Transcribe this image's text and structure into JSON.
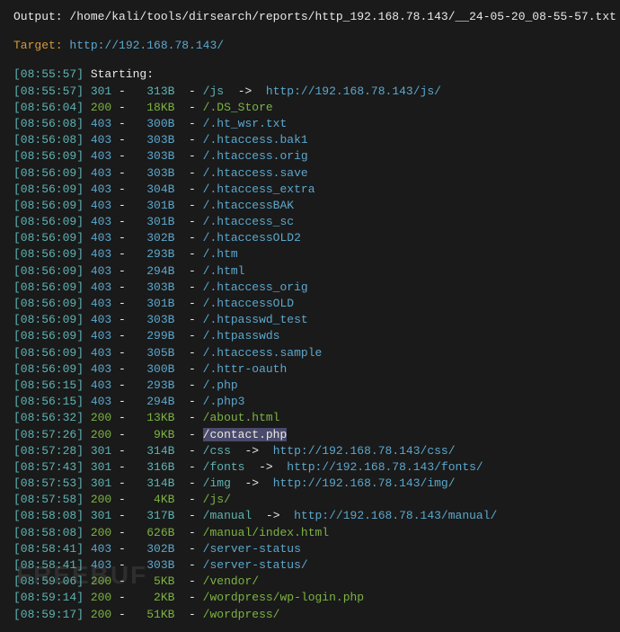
{
  "output_label": "Output: ",
  "output_path": "/home/kali/tools/dirsearch/reports/http_192.168.78.143/__24-05-20_08-55-57.txt",
  "target_label": "Target: ",
  "target_url": "http://192.168.78.143/",
  "starting_ts": "[08:55:57]",
  "starting_label": " Starting: ",
  "rows": [
    {
      "ts": "[08:55:57]",
      "st": "301",
      "sz": "313B",
      "path": "/js ",
      "arrow": " ->",
      "redir": "  http://192.168.78.143/js/",
      "sc": "cyan"
    },
    {
      "ts": "[08:56:04]",
      "st": "200",
      "sz": "18KB",
      "path": "/.DS_Store",
      "sc": "green"
    },
    {
      "ts": "[08:56:08]",
      "st": "403",
      "sz": "300B",
      "path": "/.ht_wsr.txt",
      "sc": "blue"
    },
    {
      "ts": "[08:56:08]",
      "st": "403",
      "sz": "303B",
      "path": "/.htaccess.bak1",
      "sc": "blue"
    },
    {
      "ts": "[08:56:09]",
      "st": "403",
      "sz": "303B",
      "path": "/.htaccess.orig",
      "sc": "blue"
    },
    {
      "ts": "[08:56:09]",
      "st": "403",
      "sz": "303B",
      "path": "/.htaccess.save",
      "sc": "blue"
    },
    {
      "ts": "[08:56:09]",
      "st": "403",
      "sz": "304B",
      "path": "/.htaccess_extra",
      "sc": "blue"
    },
    {
      "ts": "[08:56:09]",
      "st": "403",
      "sz": "301B",
      "path": "/.htaccessBAK",
      "sc": "blue"
    },
    {
      "ts": "[08:56:09]",
      "st": "403",
      "sz": "301B",
      "path": "/.htaccess_sc",
      "sc": "blue"
    },
    {
      "ts": "[08:56:09]",
      "st": "403",
      "sz": "302B",
      "path": "/.htaccessOLD2",
      "sc": "blue"
    },
    {
      "ts": "[08:56:09]",
      "st": "403",
      "sz": "293B",
      "path": "/.htm",
      "sc": "blue"
    },
    {
      "ts": "[08:56:09]",
      "st": "403",
      "sz": "294B",
      "path": "/.html",
      "sc": "blue"
    },
    {
      "ts": "[08:56:09]",
      "st": "403",
      "sz": "303B",
      "path": "/.htaccess_orig",
      "sc": "blue"
    },
    {
      "ts": "[08:56:09]",
      "st": "403",
      "sz": "301B",
      "path": "/.htaccessOLD",
      "sc": "blue"
    },
    {
      "ts": "[08:56:09]",
      "st": "403",
      "sz": "303B",
      "path": "/.htpasswd_test",
      "sc": "blue"
    },
    {
      "ts": "[08:56:09]",
      "st": "403",
      "sz": "299B",
      "path": "/.htpasswds",
      "sc": "blue"
    },
    {
      "ts": "[08:56:09]",
      "st": "403",
      "sz": "305B",
      "path": "/.htaccess.sample",
      "sc": "blue"
    },
    {
      "ts": "[08:56:09]",
      "st": "403",
      "sz": "300B",
      "path": "/.httr-oauth",
      "sc": "blue"
    },
    {
      "ts": "[08:56:15]",
      "st": "403",
      "sz": "293B",
      "path": "/.php",
      "sc": "blue"
    },
    {
      "ts": "[08:56:15]",
      "st": "403",
      "sz": "294B",
      "path": "/.php3",
      "sc": "blue"
    },
    {
      "ts": "[08:56:32]",
      "st": "200",
      "sz": "13KB",
      "path": "/about.html",
      "sc": "green"
    },
    {
      "ts": "[08:57:26]",
      "st": "200",
      "sz": "9KB",
      "path": "/contact.php",
      "sc": "green",
      "hl": true
    },
    {
      "ts": "[08:57:28]",
      "st": "301",
      "sz": "314B",
      "path": "/css ",
      "arrow": " ->",
      "redir": "  http://192.168.78.143/css/",
      "sc": "cyan"
    },
    {
      "ts": "[08:57:43]",
      "st": "301",
      "sz": "316B",
      "path": "/fonts ",
      "arrow": " ->",
      "redir": "  http://192.168.78.143/fonts/",
      "sc": "cyan"
    },
    {
      "ts": "[08:57:53]",
      "st": "301",
      "sz": "314B",
      "path": "/img ",
      "arrow": " ->",
      "redir": "  http://192.168.78.143/img/",
      "sc": "cyan"
    },
    {
      "ts": "[08:57:58]",
      "st": "200",
      "sz": "4KB",
      "path": "/js/",
      "sc": "green"
    },
    {
      "ts": "[08:58:08]",
      "st": "301",
      "sz": "317B",
      "path": "/manual ",
      "arrow": " ->",
      "redir": "  http://192.168.78.143/manual/",
      "sc": "cyan"
    },
    {
      "ts": "[08:58:08]",
      "st": "200",
      "sz": "626B",
      "path": "/manual/index.html",
      "sc": "green"
    },
    {
      "ts": "[08:58:41]",
      "st": "403",
      "sz": "302B",
      "path": "/server-status",
      "sc": "blue"
    },
    {
      "ts": "[08:58:41]",
      "st": "403",
      "sz": "303B",
      "path": "/server-status/",
      "sc": "blue"
    },
    {
      "ts": "[08:59:06]",
      "st": "200",
      "sz": "5KB",
      "path": "/vendor/",
      "sc": "green"
    },
    {
      "ts": "[08:59:14]",
      "st": "200",
      "sz": "2KB",
      "path": "/wordpress/wp-login.php",
      "sc": "green"
    },
    {
      "ts": "[08:59:17]",
      "st": "200",
      "sz": "51KB",
      "path": "/wordpress/",
      "sc": "green"
    }
  ],
  "watermark": "FREEBUF"
}
